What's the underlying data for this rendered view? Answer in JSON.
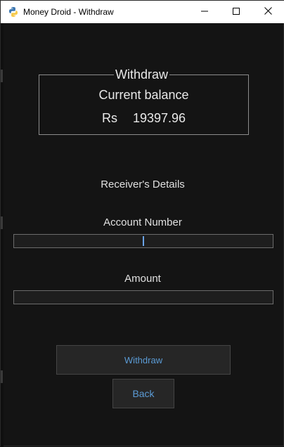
{
  "window": {
    "title": "Money Droid - Withdraw",
    "icon": "python-icon"
  },
  "balance": {
    "frame_title": "Withdraw",
    "heading": "Current balance",
    "currency": "Rs",
    "amount": "19397.96"
  },
  "form": {
    "section_title": "Receiver's Details",
    "account_label": "Account Number",
    "account_value": "",
    "amount_label": "Amount",
    "amount_value": ""
  },
  "buttons": {
    "withdraw_label": "Withdraw",
    "back_label": "Back"
  },
  "colors": {
    "background": "#141414",
    "text": "#e8e8e8",
    "button_text": "#5b9bd5",
    "caret": "#6aa4e8"
  }
}
